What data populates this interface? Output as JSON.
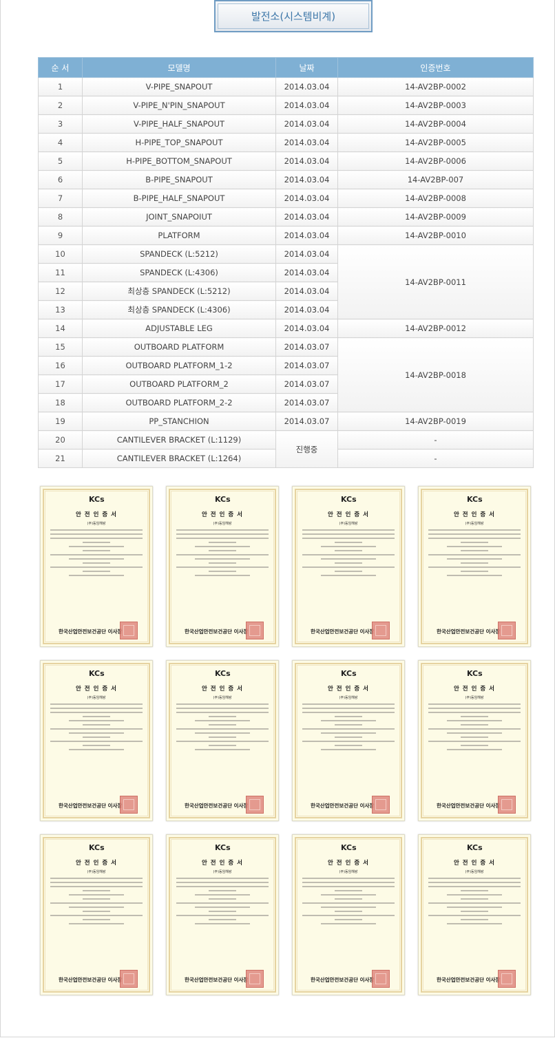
{
  "header": {
    "title": "발전소(시스템비계)"
  },
  "table": {
    "columns": [
      "순 서",
      "모델명",
      "날짜",
      "인증번호"
    ],
    "rows": [
      {
        "no": "1",
        "model": "V-PIPE_SNAPOUT",
        "date": "2014.03.04",
        "cert": "14-AV2BP-0002"
      },
      {
        "no": "2",
        "model": "V-PIPE_N'PIN_SNAPOUT",
        "date": "2014.03.04",
        "cert": "14-AV2BP-0003"
      },
      {
        "no": "3",
        "model": "V-PIPE_HALF_SNAPOUT",
        "date": "2014.03.04",
        "cert": "14-AV2BP-0004"
      },
      {
        "no": "4",
        "model": "H-PIPE_TOP_SNAPOUT",
        "date": "2014.03.04",
        "cert": "14-AV2BP-0005"
      },
      {
        "no": "5",
        "model": "H-PIPE_BOTTOM_SNAPOUT",
        "date": "2014.03.04",
        "cert": "14-AV2BP-0006"
      },
      {
        "no": "6",
        "model": "B-PIPE_SNAPOUT",
        "date": "2014.03.04",
        "cert": "14-AV2BP-007"
      },
      {
        "no": "7",
        "model": "B-PIPE_HALF_SNAPOUT",
        "date": "2014.03.04",
        "cert": "14-AV2BP-0008"
      },
      {
        "no": "8",
        "model": "JOINT_SNAPOIUT",
        "date": "2014.03.04",
        "cert": "14-AV2BP-0009"
      },
      {
        "no": "9",
        "model": "PLATFORM",
        "date": "2014.03.04",
        "cert": "14-AV2BP-0010"
      },
      {
        "no": "10",
        "model": "SPANDECK (L:5212)",
        "date": "2014.03.04",
        "cert": "14-AV2BP-0011"
      },
      {
        "no": "11",
        "model": "SPANDECK (L:4306)",
        "date": "2014.03.04"
      },
      {
        "no": "12",
        "model": "최상층 SPANDECK (L:5212)",
        "date": "2014.03.04"
      },
      {
        "no": "13",
        "model": "최상층 SPANDECK (L:4306)",
        "date": "2014.03.04"
      },
      {
        "no": "14",
        "model": "ADJUSTABLE LEG",
        "date": "2014.03.04",
        "cert": "14-AV2BP-0012"
      },
      {
        "no": "15",
        "model": "OUTBOARD PLATFORM",
        "date": "2014.03.07",
        "cert": "14-AV2BP-0018"
      },
      {
        "no": "16",
        "model": "OUTBOARD PLATFORM_1-2",
        "date": "2014.03.07"
      },
      {
        "no": "17",
        "model": "OUTBOARD PLATFORM_2",
        "date": "2014.03.07"
      },
      {
        "no": "18",
        "model": "OUTBOARD PLATFORM_2-2",
        "date": "2014.03.07"
      },
      {
        "no": "19",
        "model": "PP_STANCHION",
        "date": "2014.03.07",
        "cert": "14-AV2BP-0019"
      },
      {
        "no": "20",
        "model": "CANTILEVER BRACKET (L:1129)",
        "date": "진행중",
        "cert": "-"
      },
      {
        "no": "21",
        "model": "CANTILEVER BRACKET (L:1264)",
        "cert": "-"
      }
    ]
  },
  "certificates": {
    "title": "안 전 인 증 서",
    "company": "(주)동임해랑",
    "issuer": "한국산업안전보건공단 이사장",
    "logo": "KCs",
    "count": 12
  }
}
